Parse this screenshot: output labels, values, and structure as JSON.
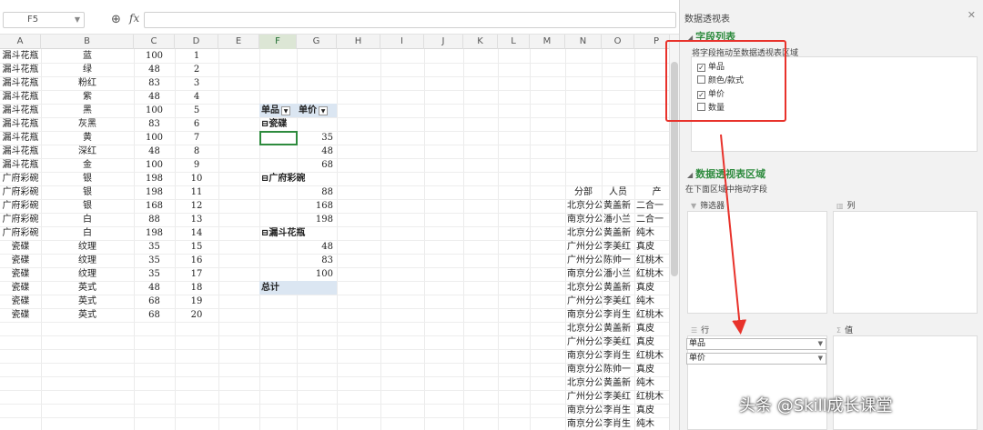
{
  "formula_bar": {
    "name_box": "F5",
    "fx_label": "fx",
    "formula": ""
  },
  "columns": [
    "A",
    "B",
    "C",
    "D",
    "E",
    "F",
    "G",
    "H",
    "I",
    "J",
    "K",
    "L",
    "M",
    "N",
    "O",
    "P"
  ],
  "data_rows": [
    [
      "漏斗花瓶",
      "蓝",
      "100",
      "1"
    ],
    [
      "漏斗花瓶",
      "绿",
      "48",
      "2"
    ],
    [
      "漏斗花瓶",
      "粉红",
      "83",
      "3"
    ],
    [
      "漏斗花瓶",
      "紫",
      "48",
      "4"
    ],
    [
      "漏斗花瓶",
      "黑",
      "100",
      "5"
    ],
    [
      "漏斗花瓶",
      "灰黑",
      "83",
      "6"
    ],
    [
      "漏斗花瓶",
      "黄",
      "100",
      "7"
    ],
    [
      "漏斗花瓶",
      "深红",
      "48",
      "8"
    ],
    [
      "漏斗花瓶",
      "金",
      "100",
      "9"
    ],
    [
      "广府彩碗",
      "银",
      "198",
      "10"
    ],
    [
      "广府彩碗",
      "银",
      "198",
      "11"
    ],
    [
      "广府彩碗",
      "银",
      "168",
      "12"
    ],
    [
      "广府彩碗",
      "白",
      "88",
      "13"
    ],
    [
      "广府彩碗",
      "白",
      "198",
      "14"
    ],
    [
      "瓷碟",
      "纹理",
      "35",
      "15"
    ],
    [
      "瓷碟",
      "纹理",
      "35",
      "16"
    ],
    [
      "瓷碟",
      "纹理",
      "35",
      "17"
    ],
    [
      "瓷碟",
      "英式",
      "48",
      "18"
    ],
    [
      "瓷碟",
      "英式",
      "68",
      "19"
    ],
    [
      "瓷碟",
      "英式",
      "68",
      "20"
    ]
  ],
  "pivot": {
    "header_1": "单品",
    "header_2": "单价",
    "groups": [
      {
        "label": "⊟瓷碟",
        "values": [
          "35",
          "48",
          "68"
        ]
      },
      {
        "label": "⊟广府彩碗",
        "values": [
          "88",
          "168",
          "198"
        ]
      },
      {
        "label": "⊟漏斗花瓶",
        "values": [
          "48",
          "83",
          "100"
        ]
      }
    ],
    "total_label": "总计"
  },
  "right_table": {
    "headers": [
      "分部",
      "人员",
      "产"
    ],
    "rows": [
      [
        "北京分公",
        "黄盖新",
        "二合一"
      ],
      [
        "南京分公",
        "潘小兰",
        "二合一"
      ],
      [
        "北京分公",
        "黄盖新",
        "纯木"
      ],
      [
        "广州分公",
        "李美红",
        "真皮"
      ],
      [
        "广州分公",
        "陈帅一",
        "红桃木"
      ],
      [
        "南京分公",
        "潘小兰",
        "红桃木"
      ],
      [
        "北京分公",
        "黄盖新",
        "真皮"
      ],
      [
        "广州分公",
        "李美红",
        "纯木"
      ],
      [
        "南京分公",
        "李肖生",
        "红桃木"
      ],
      [
        "北京分公",
        "黄盖新",
        "真皮"
      ],
      [
        "广州分公",
        "李美红",
        "真皮"
      ],
      [
        "南京分公",
        "李肖生",
        "红桃木"
      ],
      [
        "南京分公",
        "陈帅一",
        "真皮"
      ],
      [
        "北京分公",
        "黄盖新",
        "纯木"
      ],
      [
        "广州分公",
        "李美红",
        "红桃木"
      ],
      [
        "南京分公",
        "李肖生",
        "真皮"
      ],
      [
        "南京分公",
        "李肖生",
        "纯木"
      ]
    ]
  },
  "panel": {
    "title": "数据透视表",
    "field_list_title": "字段列表",
    "field_hint": "将字段拖动至数据透视表区域",
    "fields": [
      {
        "label": "单品",
        "checked": true,
        "mark": "✓"
      },
      {
        "label": "颜色/款式",
        "checked": false,
        "mark": ""
      },
      {
        "label": "单价",
        "checked": true,
        "mark": "✓"
      },
      {
        "label": "数量",
        "checked": false,
        "mark": ""
      }
    ],
    "area_title": "数据透视表区域",
    "area_hint": "在下面区域中拖动字段",
    "filter_label": "筛选器",
    "column_label": "列",
    "row_label": "行",
    "value_label": "值",
    "row_fields": [
      "单品",
      "单价"
    ]
  },
  "watermark": "头条 @Skill成长课堂",
  "colors": {
    "accent": "#2e8b3e",
    "highlight_red": "#e8322b",
    "pivot_header": "#dbe6f2"
  }
}
